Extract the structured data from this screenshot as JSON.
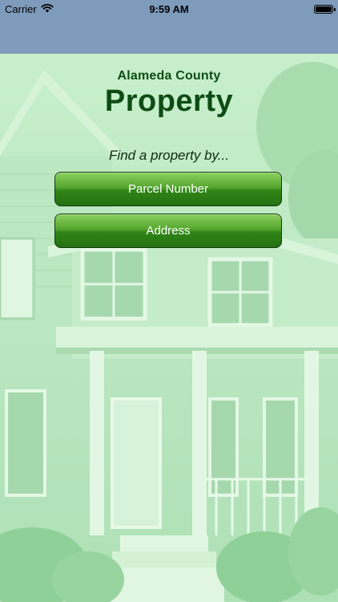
{
  "status_bar": {
    "carrier": "Carrier",
    "time": "9:59 AM",
    "icons": [
      "wifi-icon",
      "battery-icon"
    ]
  },
  "header": {
    "county": "Alameda County",
    "title": "Property"
  },
  "prompt": "Find a property by...",
  "buttons": [
    {
      "label": "Parcel Number"
    },
    {
      "label": "Address"
    }
  ],
  "colors": {
    "nav_bar": "#7f9bbc",
    "title_green": "#0e4c16",
    "button_green": "#3f8d20",
    "background_tint": "#bfe9c4"
  }
}
